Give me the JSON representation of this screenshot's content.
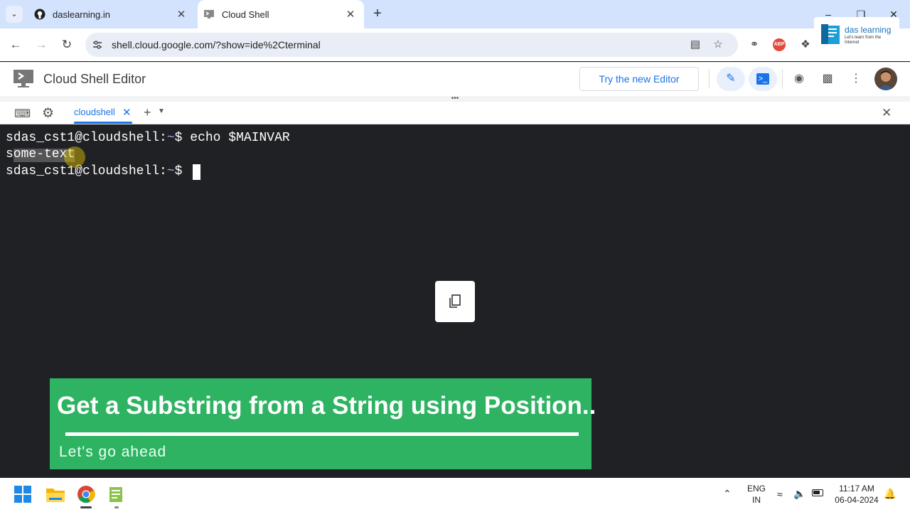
{
  "browser": {
    "tabs": [
      {
        "title": "daslearning.in"
      },
      {
        "title": "Cloud Shell"
      }
    ],
    "url": "shell.cloud.google.com/?show=ide%2Cterminal"
  },
  "logo": {
    "name": "das learning",
    "tagline": "Let's learn from the Internet"
  },
  "app": {
    "title": "Cloud Shell Editor",
    "try_button": "Try the new Editor"
  },
  "terminal": {
    "tab_label": "cloudshell",
    "lines": [
      {
        "prompt": "sdas_cst1@cloudshell:",
        "path": "~",
        "sym": "$ ",
        "cmd": "echo $MAINVAR"
      },
      {
        "output": "some-text"
      },
      {
        "prompt": "sdas_cst1@cloudshell:",
        "path": "~",
        "sym": "$ ",
        "cmd": ""
      }
    ]
  },
  "banner": {
    "title": "Get a Substring from a String using Position..",
    "subtitle": "Let's go ahead"
  },
  "taskbar": {
    "lang_top": "ENG",
    "lang_bottom": "IN",
    "time": "11:17 AM",
    "date": "06-04-2024"
  },
  "colors": {
    "terminal_bg": "#202124",
    "banner_green": "#2eb362",
    "accent_blue": "#1a73e8"
  }
}
